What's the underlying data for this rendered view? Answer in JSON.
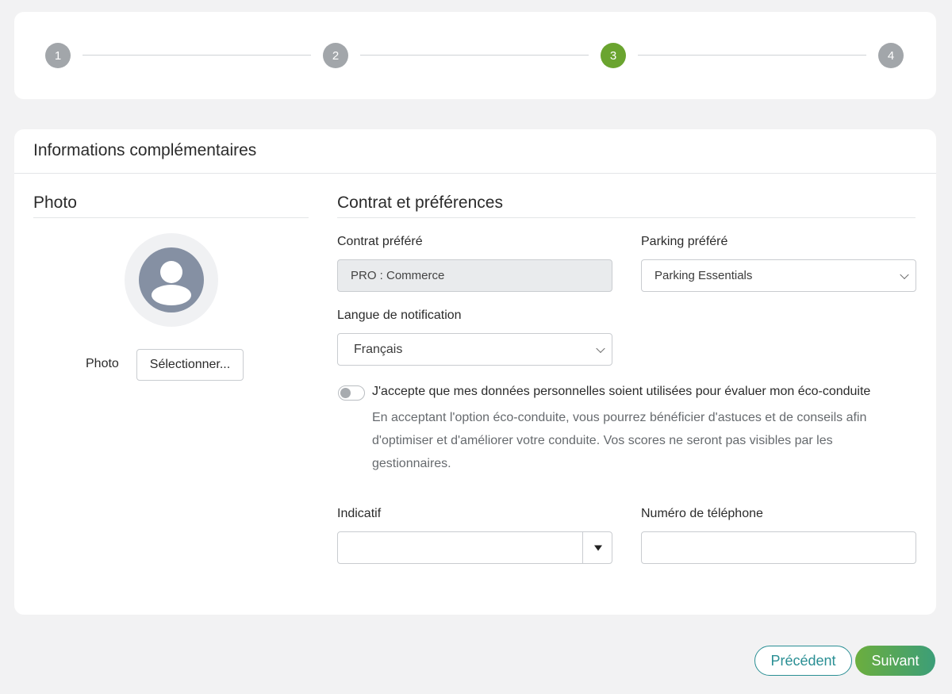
{
  "stepper": {
    "steps": [
      {
        "label": "1",
        "active": false
      },
      {
        "label": "2",
        "active": false
      },
      {
        "label": "3",
        "active": true
      },
      {
        "label": "4",
        "active": false
      }
    ],
    "colors": {
      "active": "#6aa42f",
      "inactive": "#a2a6aa"
    }
  },
  "card": {
    "title": "Informations complémentaires"
  },
  "photo_section": {
    "title": "Photo",
    "photo_label": "Photo",
    "select_button": "Sélectionner..."
  },
  "contract_section": {
    "title": "Contrat et préférences",
    "contract_label": "Contrat préféré",
    "contract_value": "PRO : Commerce",
    "parking_label": "Parking préféré",
    "parking_value": "Parking Essentials",
    "language_label": "Langue de notification",
    "language_value": "Français",
    "consent_text": "J'accepte que mes données personnelles soient utilisées pour évaluer mon éco-conduite",
    "consent_help": "En acceptant l'option éco-conduite, vous pourrez bénéficier d'astuces et de conseils afin d'optimiser et d'améliorer votre conduite. Vos scores ne seront pas visibles par les gestionnaires.",
    "consent_checked": false,
    "dial_code_label": "Indicatif",
    "dial_code_value": "",
    "phone_label": "Numéro de téléphone",
    "phone_value": ""
  },
  "footer": {
    "prev_button": "Précédent",
    "next_button": "Suivant",
    "colors": {
      "prev": "#2a8f94",
      "next_start": "#6cae3e",
      "next_end": "#3c9e78"
    }
  }
}
